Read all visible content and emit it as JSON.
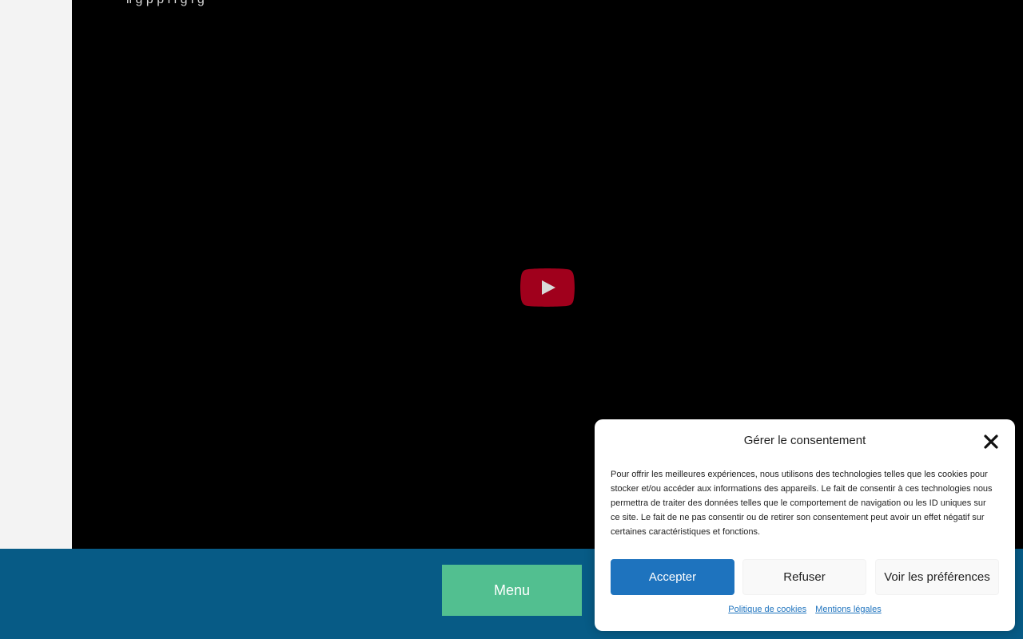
{
  "video": {
    "caption": "ll g p p l l g l g",
    "play_label": "Lire"
  },
  "footer": {
    "menu_label": "Menu"
  },
  "consent": {
    "title": "Gérer le consentement",
    "text": "Pour offrir les meilleures expériences, nous utilisons des technologies telles que les cookies pour stocker et/ou accéder aux informations des appareils. Le fait de consentir à ces technologies nous permettra de traiter des données telles que le comportement de navigation ou les ID uniques sur ce site. Le fait de ne pas consentir ou de retirer son consentement peut avoir un effet négatif sur certaines caractéristiques et fonctions.",
    "accept_label": "Accepter",
    "refuse_label": "Refuser",
    "prefs_label": "Voir les préférences",
    "links": [
      "Politique de cookies",
      "Mentions légales"
    ]
  },
  "colors": {
    "footer_bg": "#075b86",
    "menu_button": "#52bf90",
    "accept_button": "#1e73be",
    "play_button": "#a0001c"
  },
  "icons": {
    "play": "youtube-play-icon",
    "close": "close-icon"
  }
}
